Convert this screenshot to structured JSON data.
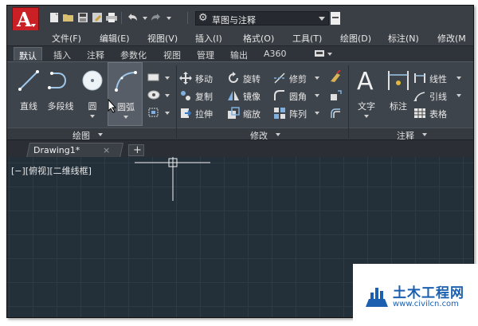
{
  "titlebar": {
    "app_logo_letter": "A",
    "workspace_name": "草图与注释"
  },
  "menu": [
    "文件(F)",
    "编辑(E)",
    "视图(V)",
    "插入(I)",
    "格式(O)",
    "工具(T)",
    "绘图(D)",
    "标注(N)",
    "修改(M"
  ],
  "ribbon_tabs": [
    "默认",
    "插入",
    "注释",
    "参数化",
    "视图",
    "管理",
    "输出",
    "A360"
  ],
  "active_ribbon_tab": "默认",
  "panels": {
    "draw": {
      "title": "绘图",
      "tools": [
        "直线",
        "多段线",
        "圆",
        "圆弧"
      ]
    },
    "modify": {
      "title": "修改",
      "tools": [
        "移动",
        "旋转",
        "修剪",
        "复制",
        "镜像",
        "圆角",
        "拉伸",
        "缩放",
        "阵列"
      ]
    },
    "annotation": {
      "title": "注释",
      "tools": [
        "文字",
        "标注",
        "线性",
        "引线",
        "表格"
      ]
    }
  },
  "document_tab": {
    "label": "Drawing1*",
    "close_glyph": "×",
    "add_glyph": "+"
  },
  "canvas": {
    "viewport_label": "[−][俯视][二维线框]"
  },
  "watermark": {
    "title": "土木工程网",
    "url": "www.civilcn.com"
  },
  "colors": {
    "brand_red": "#c91f25",
    "canvas_bg": "#243039",
    "ribbon_bg": "#3e444b",
    "watermark_blue": "#1b5fb0"
  }
}
